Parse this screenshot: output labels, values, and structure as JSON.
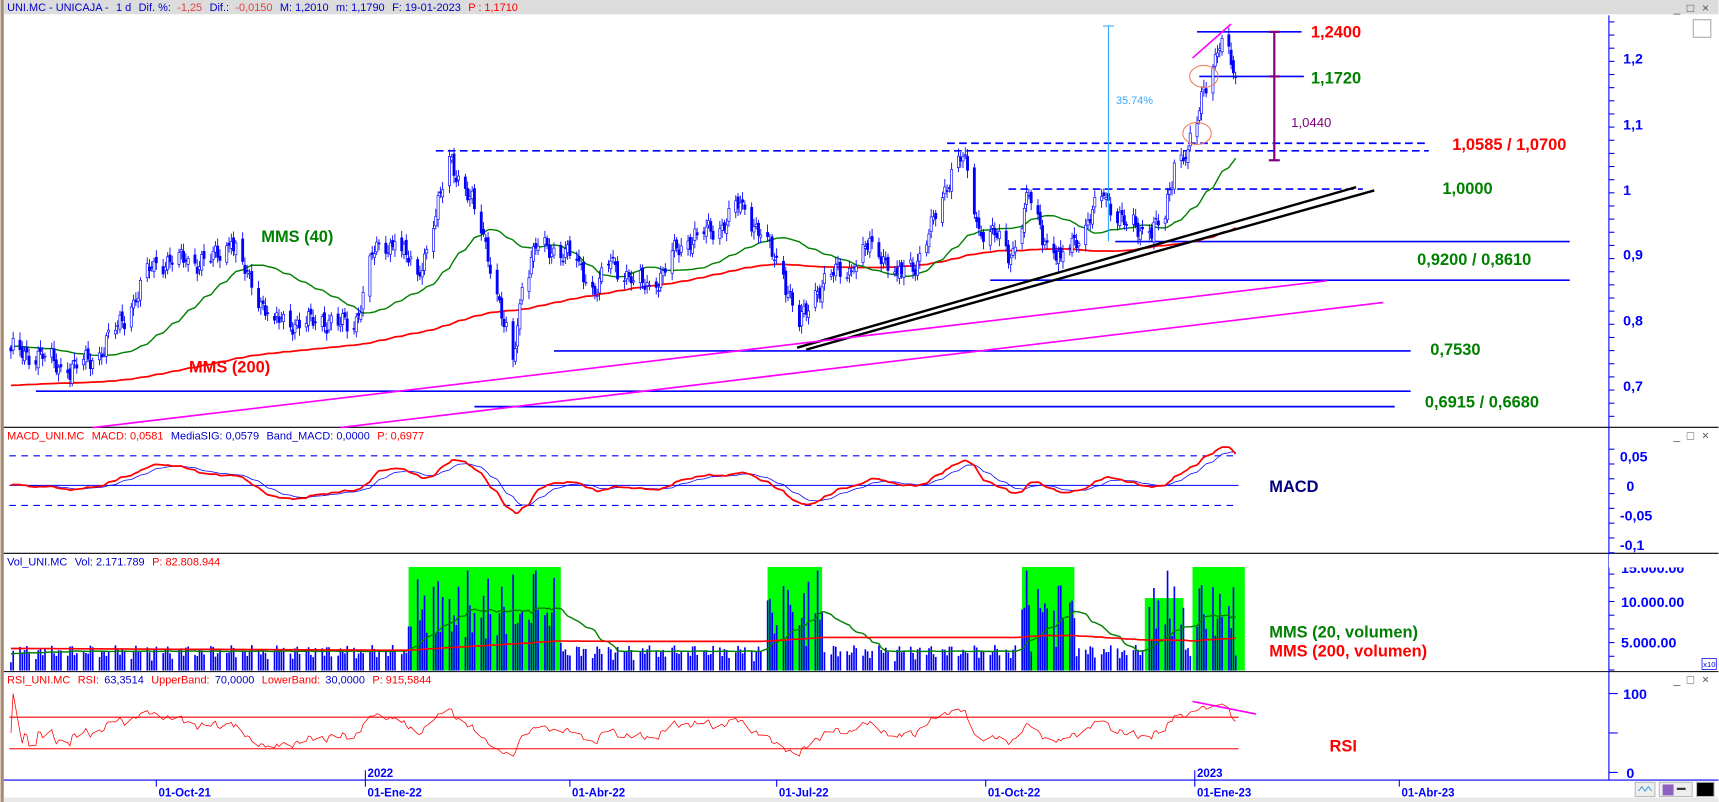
{
  "header": {
    "symbol": "UNI.MC - UNICAJA -",
    "period": "1 d",
    "dif_pct_label": "Dif. %:",
    "dif_pct": "-1,25",
    "dif_label": "Dif.:",
    "dif": "-0,0150",
    "max_label": "M: 1,2010",
    "min_label": "m: 1,1790",
    "date_label": "F: 19-01-2023",
    "price_label": "P : 1,1710"
  },
  "macd_header": {
    "name": "MACD_UNI.MC",
    "macd": "MACD: 0,0581",
    "sig": "MediaSIG: 0,0579",
    "band": "Band_MACD: 0,0000",
    "p": "P: 0,6977"
  },
  "vol_header": {
    "name": "Vol_UNI.MC",
    "vol": "Vol: 2.171.789",
    "p": "P: 82.808.944"
  },
  "rsi_header": {
    "name": "RSI_UNI.MC",
    "rsi_label": "RSI:",
    "rsi": "63,3514",
    "upper_label": "UpperBand:",
    "upper": "70,0000",
    "lower_label": "LowerBand:",
    "lower": "30,0000",
    "p": "P: 915,5844"
  },
  "window_controls": {
    "minimize": "_",
    "maximize": "□",
    "close": "×"
  },
  "axis_multiplier": "x10",
  "colors": {
    "candles": "#0000ff",
    "mms40": "#008000",
    "mms200": "#ff0000",
    "volume_highlight": "#00ff00",
    "trend": "#000000",
    "channel": "#ff00ff",
    "levels": "#0000ff",
    "measure": "#800080",
    "pct_arrow": "#33aaff"
  },
  "chart_data": [
    {
      "type": "candlestick",
      "panel": "price",
      "y_ticks": [
        "1,2",
        "1,1",
        "1",
        "0,9",
        "0,8",
        "0,7"
      ],
      "ylim": [
        0.63,
        1.27
      ],
      "x_ticks": [
        {
          "date": "2021-10-01",
          "label": "01-Oct-21"
        },
        {
          "date": "2022-01-01",
          "label": "01-Ene-22",
          "year": "2022"
        },
        {
          "date": "2022-04-01",
          "label": "01-Abr-22"
        },
        {
          "date": "2022-07-01",
          "label": "01-Jul-22"
        },
        {
          "date": "2022-10-01",
          "label": "01-Oct-22"
        },
        {
          "date": "2023-01-01",
          "label": "01-Ene-23",
          "year": "2023"
        },
        {
          "date": "2023-04-01",
          "label": "01-Abr-23"
        }
      ],
      "close_keypoints": [
        [
          "2021-07-29",
          0.753
        ],
        [
          "2021-08-13",
          0.745
        ],
        [
          "2021-08-23",
          0.72
        ],
        [
          "2021-09-06",
          0.75
        ],
        [
          "2021-09-20",
          0.82
        ],
        [
          "2021-09-30",
          0.89
        ],
        [
          "2021-10-14",
          0.89
        ],
        [
          "2021-10-25",
          0.89
        ],
        [
          "2021-11-03",
          0.92
        ],
        [
          "2021-11-12",
          0.85
        ],
        [
          "2021-11-22",
          0.8
        ],
        [
          "2021-12-06",
          0.795
        ],
        [
          "2021-12-16",
          0.8
        ],
        [
          "2021-12-27",
          0.787
        ],
        [
          "2022-01-04",
          0.9
        ],
        [
          "2022-01-14",
          0.92
        ],
        [
          "2022-01-24",
          0.87
        ],
        [
          "2022-01-31",
          0.94
        ],
        [
          "2022-02-07",
          1.05
        ],
        [
          "2022-02-11",
          1.02
        ],
        [
          "2022-02-18",
          0.97
        ],
        [
          "2022-02-23",
          0.92
        ],
        [
          "2022-02-28",
          0.84
        ],
        [
          "2022-03-03",
          0.79
        ],
        [
          "2022-03-07",
          0.74
        ],
        [
          "2022-03-11",
          0.85
        ],
        [
          "2022-03-17",
          0.91
        ],
        [
          "2022-03-25",
          0.91
        ],
        [
          "2022-04-05",
          0.89
        ],
        [
          "2022-04-12",
          0.84
        ],
        [
          "2022-04-19",
          0.89
        ],
        [
          "2022-04-29",
          0.86
        ],
        [
          "2022-05-09",
          0.85
        ],
        [
          "2022-05-18",
          0.91
        ],
        [
          "2022-05-27",
          0.93
        ],
        [
          "2022-06-07",
          0.945
        ],
        [
          "2022-06-16",
          0.98
        ],
        [
          "2022-06-24",
          0.93
        ],
        [
          "2022-07-04",
          0.87
        ],
        [
          "2022-07-11",
          0.79
        ],
        [
          "2022-07-18",
          0.845
        ],
        [
          "2022-07-25",
          0.87
        ],
        [
          "2022-08-04",
          0.88
        ],
        [
          "2022-08-12",
          0.92
        ],
        [
          "2022-08-23",
          0.87
        ],
        [
          "2022-09-01",
          0.89
        ],
        [
          "2022-09-09",
          0.955
        ],
        [
          "2022-09-16",
          1.03
        ],
        [
          "2022-09-21",
          1.05
        ],
        [
          "2022-09-28",
          0.94
        ],
        [
          "2022-10-05",
          0.93
        ],
        [
          "2022-10-12",
          0.895
        ],
        [
          "2022-10-20",
          0.99
        ],
        [
          "2022-10-27",
          0.92
        ],
        [
          "2022-11-03",
          0.895
        ],
        [
          "2022-11-14",
          0.945
        ],
        [
          "2022-11-22",
          0.99
        ],
        [
          "2022-12-02",
          0.945
        ],
        [
          "2022-12-12",
          0.935
        ],
        [
          "2022-12-19",
          0.955
        ],
        [
          "2022-12-23",
          1.04
        ],
        [
          "2022-12-29",
          1.06
        ],
        [
          "2023-01-02",
          1.1
        ],
        [
          "2023-01-05",
          1.155
        ],
        [
          "2023-01-10",
          1.205
        ],
        [
          "2023-01-13",
          1.23
        ],
        [
          "2023-01-19",
          1.171
        ]
      ],
      "series": [
        {
          "name": "MMS (40)",
          "color": "#008000",
          "period": 40
        },
        {
          "name": "MMS (200)",
          "color": "#ff0000",
          "period": 200
        }
      ],
      "levels": [
        {
          "value": 1.24,
          "label": "1,2400",
          "from": "2023-01-02",
          "to": "2023-02-17",
          "style": "solid",
          "label_color": "#ff0000"
        },
        {
          "value": 1.172,
          "label": "1,1720",
          "from": "2023-01-03",
          "to": "2023-02-18",
          "style": "solid",
          "label_color": "#008000"
        },
        {
          "value": 1.07,
          "from": "2022-09-14",
          "to": "2023-04-14",
          "style": "dashed"
        },
        {
          "value": 1.0585,
          "label": "1,0585 / 1,0700",
          "from": "2022-02-01",
          "to": "2023-04-14",
          "style": "dashed",
          "label_color": "#ff0000"
        },
        {
          "value": 1.0,
          "label": "1,0000",
          "from": "2022-10-11",
          "to": "2023-03-16",
          "style": "dashed",
          "label_color": "#008000"
        },
        {
          "value": 0.92,
          "label": "0,9200 / 0,8610",
          "from": "2022-11-27",
          "to": "2023-06-15",
          "style": "solid",
          "label_color": "#008000"
        },
        {
          "value": 0.861,
          "from": "2022-10-03",
          "to": "2023-06-15",
          "style": "solid"
        },
        {
          "value": 0.753,
          "label": "0,7530",
          "from": "2022-03-25",
          "to": "2023-04-06",
          "style": "solid",
          "label_color": "#008000"
        },
        {
          "value": 0.6915,
          "label": "0,6915 / 0,6680",
          "from": "2021-08-09",
          "to": "2023-04-06",
          "style": "solid",
          "label_color": "#008000"
        },
        {
          "value": 0.668,
          "from": "2022-02-18",
          "to": "2023-03-30",
          "style": "solid"
        }
      ],
      "measure": {
        "from": 1.24,
        "mid": 1.172,
        "to": 1.044,
        "label": "1,0440",
        "date": "2023-02-05"
      },
      "pct_arrow": {
        "from": 0.92,
        "to": 1.249,
        "date": "2022-11-24",
        "label": "35.74%"
      },
      "trend_lines": [
        {
          "from": [
            "2022-07-10",
            0.758
          ],
          "to": [
            "2023-03-13",
            1.003
          ],
          "color": "#000000"
        },
        {
          "from": [
            "2022-07-14",
            0.755
          ],
          "to": [
            "2023-03-21",
            0.998
          ],
          "color": "#000000"
        },
        {
          "from": [
            "2021-09-03",
            0.636
          ],
          "to": [
            "2023-02-28",
            0.86
          ],
          "color": "#ff00ff"
        },
        {
          "from": [
            "2021-12-21",
            0.636
          ],
          "to": [
            "2023-03-25",
            0.827
          ],
          "color": "#ff00ff"
        },
        {
          "from": [
            "2022-12-31",
            1.2
          ],
          "to": [
            "2023-01-17",
            1.252
          ],
          "color": "#ff00ff"
        }
      ],
      "highlights": [
        [
          "2023-01-05",
          1.172
        ],
        [
          "2023-01-02",
          1.085
        ]
      ],
      "annotations": {
        "mms40": "MMS (40)",
        "mms200": "MMS (200)"
      }
    },
    {
      "type": "line",
      "panel": "macd",
      "y_ticks": [
        "0,05",
        "0",
        "-0,05",
        "-0,1"
      ],
      "ylim": [
        -0.11,
        0.07
      ],
      "bands": [
        0.05,
        -0.034
      ],
      "series": [
        {
          "name": "MACD",
          "color": "#ff0000"
        },
        {
          "name": "MediaSIG",
          "color": "#0000ff"
        }
      ],
      "label": "MACD"
    },
    {
      "type": "bar",
      "panel": "volume",
      "y_ticks": [
        "15.000.00",
        "10.000.00",
        "5.000.00"
      ],
      "highlight_periods": [
        {
          "from": "2022-01-20",
          "to": "2022-03-28",
          "top": 15000
        },
        {
          "from": "2022-06-27",
          "to": "2022-07-21",
          "top": 15000
        },
        {
          "from": "2022-10-17",
          "to": "2022-11-09",
          "top": 15000
        },
        {
          "from": "2022-12-10",
          "to": "2022-12-27",
          "top": 10500
        },
        {
          "from": "2022-12-31",
          "to": "2023-01-23",
          "top": 15000
        }
      ],
      "series": [
        {
          "name": "MMS (20, volumen)",
          "color": "#008000",
          "period": 20
        },
        {
          "name": "MMS (200, volumen)",
          "color": "#ff0000",
          "period": 200
        }
      ]
    },
    {
      "type": "line",
      "panel": "rsi",
      "y_ticks": [
        "100",
        "0"
      ],
      "ylim": [
        0,
        100
      ],
      "bands": [
        70,
        30
      ],
      "period": 14,
      "label": "RSI",
      "trend_line": {
        "from": [
          "2022-12-31",
          90
        ],
        "to": [
          "2023-01-28",
          74
        ]
      }
    }
  ]
}
